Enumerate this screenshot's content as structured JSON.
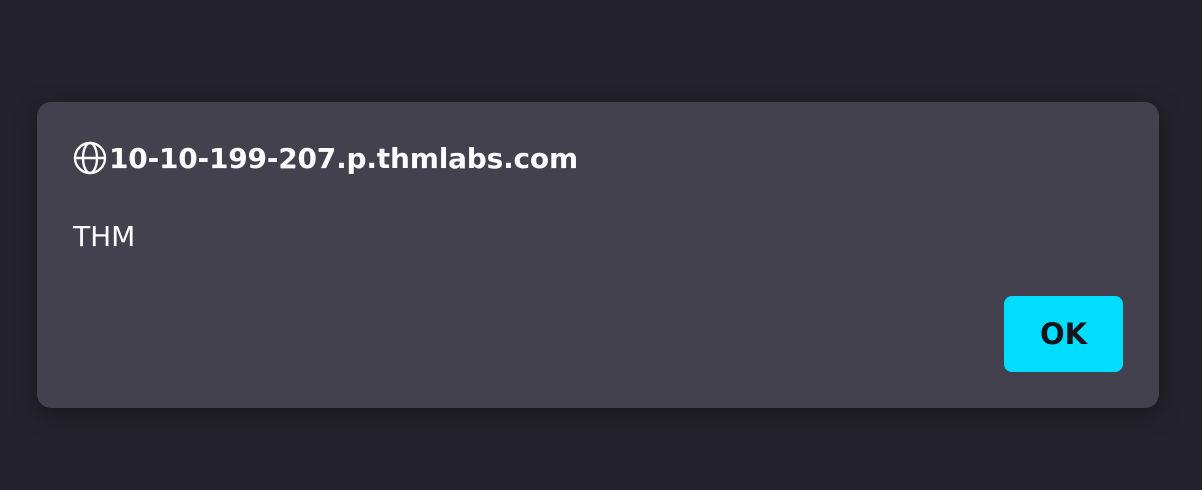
{
  "dialog": {
    "origin": "10-10-199-207.p.thmlabs.com",
    "message": "THM",
    "ok_label": "OK",
    "origin_icon": "globe-icon"
  },
  "colors": {
    "backdrop": "#24232b",
    "dialog": "#42414d",
    "text": "#fbfbfe",
    "accent": "#00ddff",
    "button_text": "#15141a"
  }
}
